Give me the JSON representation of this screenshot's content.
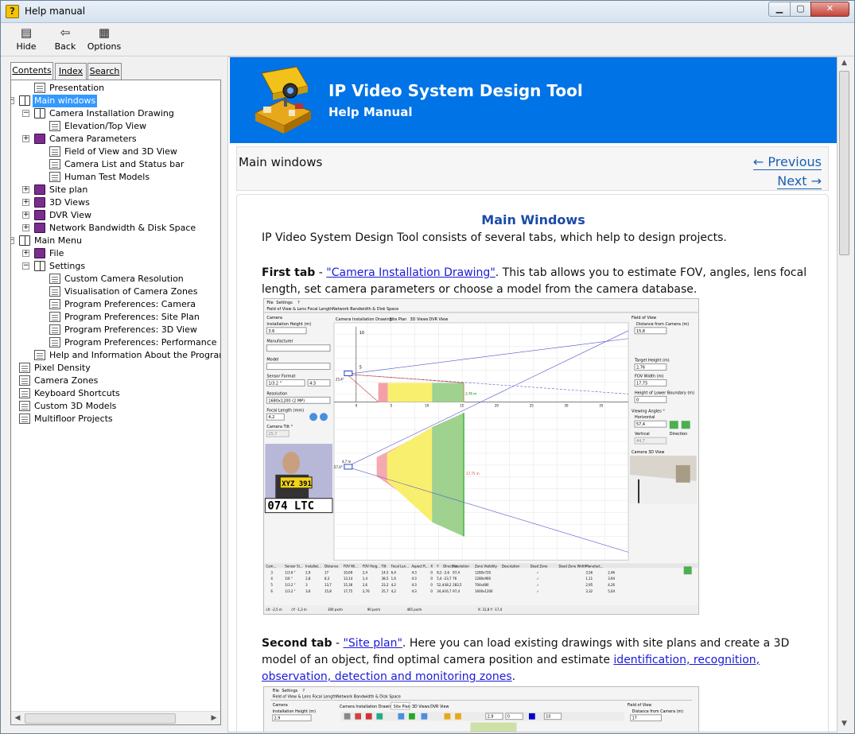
{
  "window": {
    "title": "Help manual"
  },
  "toolbar": {
    "hide": "Hide",
    "back": "Back",
    "options": "Options"
  },
  "tabs": {
    "contents": "Contents",
    "index": "Index",
    "search": "Search"
  },
  "tree": [
    {
      "label": "Presentation",
      "type": "page"
    },
    {
      "label": "Main windows",
      "type": "book-open",
      "exp": "⊟"
    },
    {
      "label": "Camera Installation Drawing",
      "type": "book-open",
      "exp": "⊟"
    },
    {
      "label": "Elevation/Top View",
      "type": "page"
    },
    {
      "label": "Camera Parameters",
      "type": "book",
      "exp": "⊞"
    },
    {
      "label": "Field of View and 3D View",
      "type": "page"
    },
    {
      "label": "Camera List and Status bar",
      "type": "page"
    },
    {
      "label": "Human Test Models",
      "type": "page"
    },
    {
      "label": "Site plan",
      "type": "book",
      "exp": "⊞"
    },
    {
      "label": "3D Views",
      "type": "book",
      "exp": "⊞"
    },
    {
      "label": "DVR View",
      "type": "book",
      "exp": "⊞"
    },
    {
      "label": "Network Bandwidth & Disk Space",
      "type": "book",
      "exp": "⊞"
    },
    {
      "label": "Main Menu",
      "type": "book-open",
      "exp": "⊟"
    },
    {
      "label": "File",
      "type": "book",
      "exp": "⊞"
    },
    {
      "label": "Settings",
      "type": "book-open",
      "exp": "⊟"
    },
    {
      "label": "Custom Camera Resolution",
      "type": "page"
    },
    {
      "label": "Visualisation of Camera Zones",
      "type": "page"
    },
    {
      "label": "Program Preferences: Camera",
      "type": "page"
    },
    {
      "label": "Program Preferences: Site Plan",
      "type": "page"
    },
    {
      "label": "Program Preferences: 3D View",
      "type": "page"
    },
    {
      "label": "Program Preferences: Performance",
      "type": "page"
    },
    {
      "label": "Help and Information About the Program",
      "type": "page"
    },
    {
      "label": "Pixel Density",
      "type": "page"
    },
    {
      "label": "Camera Zones",
      "type": "page"
    },
    {
      "label": "Keyboard Shortcuts",
      "type": "page"
    },
    {
      "label": "Custom 3D Models",
      "type": "page"
    },
    {
      "label": "Multifloor Projects",
      "type": "page"
    }
  ],
  "banner": {
    "title": "IP Video System Design Tool",
    "subtitle": "Help Manual"
  },
  "nav": {
    "title": "Main windows",
    "previous": "← Previous",
    "next": "Next →"
  },
  "article": {
    "heading": "Main Windows",
    "intro": "IP Video System Design Tool consists of several tabs, which help to design projects.",
    "first_bold": "First tab",
    "first_link": "\"Camera Installation Drawing\"",
    "first_text": ". This tab allows you to estimate FOV, angles, lens focal length, set camera parameters or choose a model from the camera database.",
    "second_bold": "Second tab",
    "second_link": "\"Site plan\"",
    "second_text": ". Here you can load existing drawings with site plans and create a 3D model of an object, find optimal camera position and estimate ",
    "second_link2": "identification, recognition, observation, detection and monitoring zones",
    "second_end": "."
  },
  "shot1": {
    "menu_file": "File",
    "menu_settings": "Settings",
    "menu_q": "?",
    "tab1": "Field of View & Lens Focal Length",
    "tab2": "Network Bandwidth & Disk Space",
    "subtab1": "Camera Installation Drawing",
    "subtab2": "Site Plan",
    "subtab3": "3D Views",
    "subtab4": "DVR View",
    "left_camera": "Camera",
    "left_height_label": "Installation Height (m)",
    "left_height": "3.6",
    "left_manufacturer": "Manufacturer",
    "left_model": "Model",
    "left_sensor_label": "Sensor Format",
    "left_sensor": "1/3.2 \"",
    "left_aspect": "4:3",
    "left_resolution_label": "Resolution",
    "left_resolution": "1680x1200 (2 MP)",
    "left_focal_label": "Focal Length (mm)",
    "left_focal": "4,2",
    "left_tilt_label": "Camera Tilt °",
    "left_tilt": "25,7",
    "plate1": "XYZ 391",
    "plate2": "074 LTC",
    "right_fov": "Field of View",
    "right_dist_label": "Distance from Camera (m)",
    "right_dist": "15,8",
    "right_target_label": "Target Height (m)",
    "right_target": "2,76",
    "right_fovw_label": "FOV Width (m)",
    "right_fovw": "17,75",
    "right_lower_label": "Height of Lower Boundary (m)",
    "right_lower": "0",
    "right_angles": "Viewing Angles °",
    "right_horiz_label": "Horizontal",
    "right_horiz": "57,4",
    "right_vert_label": "Vertical",
    "right_vert": "44,7",
    "right_direction": "Direction",
    "right_3d": "Camera 3D View",
    "ticks": [
      "0",
      "5",
      "10",
      "15",
      "20",
      "25",
      "30",
      "35"
    ],
    "axis_top_10": "10",
    "axis_top_5": "5",
    "axis_274": "25,4°",
    "axis_276": "2,76 m",
    "axis_47": "4,7 m",
    "axis_574": "57,4°",
    "axis_1775": "17,75 m",
    "table_headers": [
      "Cam...",
      "Sensor Si...",
      "Installat...",
      "Distance",
      "FOV Wi...",
      "FOV Heig...",
      "Tilt",
      "Focal Len...",
      "Aspect R...",
      "X",
      "Y",
      "Direction",
      "Resolution",
      "Zone Visibility",
      "Description",
      "Dead Zone",
      "Dead Zone Width",
      "Manufact..."
    ],
    "table_rows": [
      [
        "3",
        "1/3.6 \"",
        "2,9",
        "17",
        "10,69",
        "2,4",
        "14,5",
        "6,4",
        "4:3",
        "0",
        "8,2",
        "-3,6",
        "97,4",
        "1280x720",
        "✓",
        "",
        "3,56",
        "2,46",
        ""
      ],
      [
        "4",
        "1/6 \"",
        "2,8",
        "8,3",
        "13,14",
        "1,4",
        "38,5",
        "1,6",
        "4:3",
        "0",
        "5,4",
        "-23,7",
        "76",
        "1280x960",
        "✓",
        "",
        "1,11",
        "3,94",
        ""
      ],
      [
        "5",
        "1/3.2 \"",
        "3",
        "13,7",
        "15,36",
        "2,6",
        "23,2",
        "4,2",
        "4:3",
        "0",
        "52,4",
        "-38,2",
        "283,5",
        "704x480",
        "✓",
        "",
        "2,95",
        "4,26",
        ""
      ],
      [
        "6",
        "1/3.2 \"",
        "3,6",
        "15,8",
        "17,75",
        "2,76",
        "25,7",
        "4,2",
        "4:3",
        "0",
        "34,4",
        "-16,7",
        "97,4",
        "1600x1200",
        "✓",
        "",
        "3,32",
        "5,04",
        ""
      ]
    ],
    "status": [
      "cX: -2,5 m",
      "cY: -1,3 m",
      "300 px/m",
      "90 px/m",
      "465 px/m",
      "X: 31,8 Y: -17,4"
    ]
  },
  "shot2": {
    "menu_file": "File",
    "menu_settings": "Settings",
    "menu_q": "?",
    "tab1": "Field of View & Lens Focal Length",
    "tab2": "Network Bandwidth & Disk Space",
    "subtab1": "Camera Installation Drawing",
    "subtab2": "Site Plan",
    "subtab3": "3D Views",
    "subtab4": "DVR View",
    "left_camera": "Camera",
    "left_height_label": "Installation Height (m)",
    "left_height": "2,9",
    "tb_val1": "2,9",
    "tb_val2": "0",
    "tb_val3": "10",
    "right_fov": "Field of View",
    "right_dist_label": "Distance from Camera (m)",
    "right_dist": "17"
  }
}
